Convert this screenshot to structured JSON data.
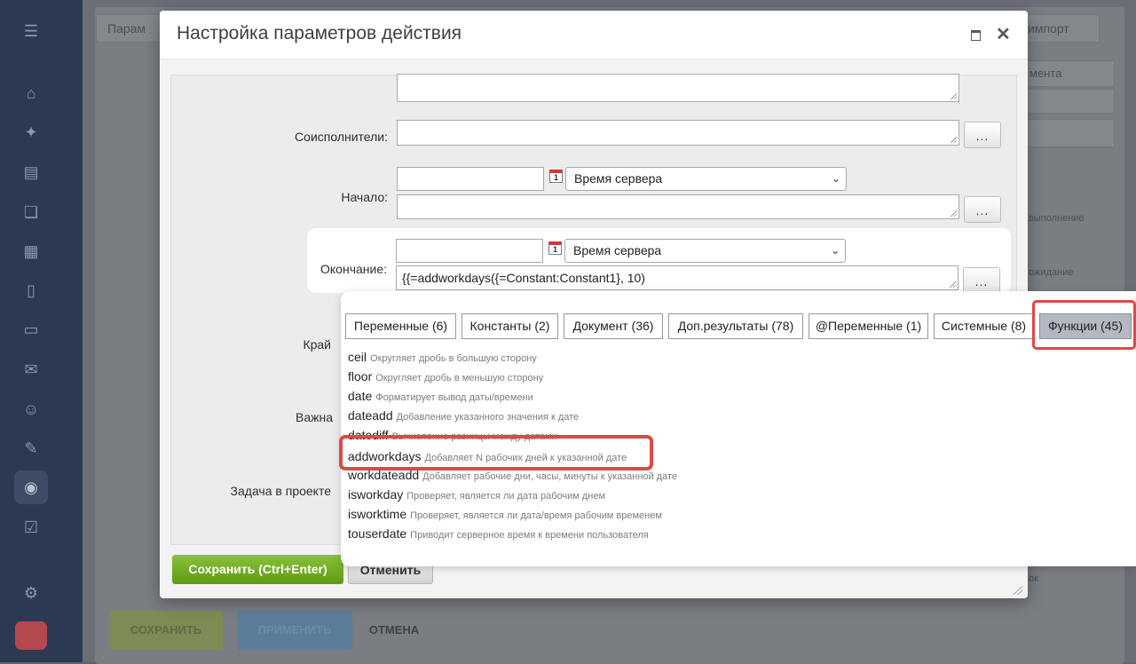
{
  "dialog": {
    "title": "Настройка параметров действия"
  },
  "form": {
    "coexecutors_label": "Соисполнители:",
    "start_label": "Начало:",
    "end_label": "Окончание:",
    "deadline_label_partial": "Край",
    "importance_label_partial": "Важна",
    "project_task_label": "Задача в проекте",
    "timezone_value": "Время сервера",
    "end_expression": "{{=addworkdays({=Constant:Constant1}, 10)",
    "dots_label": "...",
    "calendar_glyph": "1"
  },
  "buttons": {
    "save": "Сохранить (Ctrl+Enter)",
    "cancel": "Отменить"
  },
  "popup": {
    "tabs": [
      {
        "label": "Переменные (6)"
      },
      {
        "label": "Константы (2)"
      },
      {
        "label": "Документ (36)"
      },
      {
        "label": "Доп.результаты (78)"
      },
      {
        "label": "@Переменные (1)"
      },
      {
        "label": "Системные (8)"
      },
      {
        "label": "Функции (45)"
      }
    ],
    "active_tab": "Функции (45)",
    "functions": [
      {
        "name": "ceil",
        "desc": "Округляет дробь в большую сторону"
      },
      {
        "name": "floor",
        "desc": "Округляет дробь в меньшую сторону"
      },
      {
        "name": "date",
        "desc": "Форматирует вывод даты/времени"
      },
      {
        "name": "dateadd",
        "desc": "Добавление указанного значения к дате"
      },
      {
        "name": "datediff",
        "desc": "Вычисление разницы между датами"
      },
      {
        "name": "addworkdays",
        "desc": "Добавляет N рабочих дней к указанной дате"
      },
      {
        "name": "workdateadd",
        "desc": "Добавляет рабочие дни, часы, минуты к указанной дате"
      },
      {
        "name": "isworkday",
        "desc": "Проверяет, является ли дата рабочим днем"
      },
      {
        "name": "isworktime",
        "desc": "Проверяет, является ли дата/время рабочим временем"
      },
      {
        "name": "touserdate",
        "desc": "Приводит серверное время к времени пользователя"
      }
    ]
  },
  "background": {
    "tab_left_partial": "Парам",
    "tab_right_partial": "импорт",
    "right_tab_partial": "мента",
    "right_text_1": "выполнение",
    "right_text_2": "ожидание",
    "right_text_3": "ок",
    "footer_save": "СОХРАНИТЬ",
    "footer_apply": "ПРИМЕНИТЬ",
    "footer_cancel": "ОТМЕНА"
  },
  "colors": {
    "accent_save": "#6aa81c",
    "highlight_red": "#e04848",
    "active_tab_bg": "#b3b8c2",
    "sidebar_bg": "#2b3a52"
  }
}
